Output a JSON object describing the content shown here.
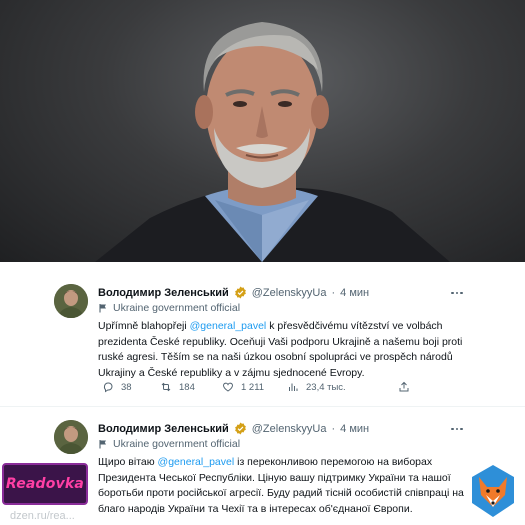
{
  "tweets": [
    {
      "author_name": "Володимир Зеленський",
      "handle": "@ZelenskyyUa",
      "separator": "·",
      "time": "4 мин",
      "affiliation": "Ukraine government official",
      "text_before_mention": "Upřímně blahopřeji ",
      "mention": "@general_pavel",
      "text_after_mention": " k přesvědčivému vítězství ve volbách prezidenta České republiky. Oceňuji Vaši podporu Ukrajině a našemu boji proti ruské agresi. Těším se na naši úzkou osobní spolupráci ve prospěch národů Ukrajiny a České republiky a v zájmu sjednocené Evropy.",
      "replies": "38",
      "retweets": "184",
      "likes": "1 211",
      "views": "23,4 тыс."
    },
    {
      "author_name": "Володимир Зеленський",
      "handle": "@ZelenskyyUa",
      "separator": "·",
      "time": "4 мин",
      "affiliation": "Ukraine government official",
      "text_before_mention": "Щиро вітаю ",
      "mention": "@general_pavel",
      "text_after_mention": " із переконливою перемогою на виборах Президента Чеської Республіки. Ціную вашу підтримку України та нашої боротьби проти російської агресії. Буду радий тісній особистій співпраці на благо народів України та Чехії та в інтересах об'єднаної Європи."
    }
  ],
  "icons": {
    "verified": "verified-badge-icon",
    "affiliation": "flag-icon",
    "more": "more-dots-icon",
    "reply": "reply-icon",
    "retweet": "retweet-icon",
    "like": "heart-icon",
    "views": "views-chart-icon",
    "share": "share-icon"
  },
  "watermarks": {
    "brand": "Readovka",
    "url": "dzen.ru/rea..."
  },
  "colors": {
    "mention": "#1d9bf0",
    "secondary_text": "#536471",
    "verified_gold": "#d4a017",
    "brand_bg": "#3b1449",
    "brand_text": "#ff3fa5"
  }
}
